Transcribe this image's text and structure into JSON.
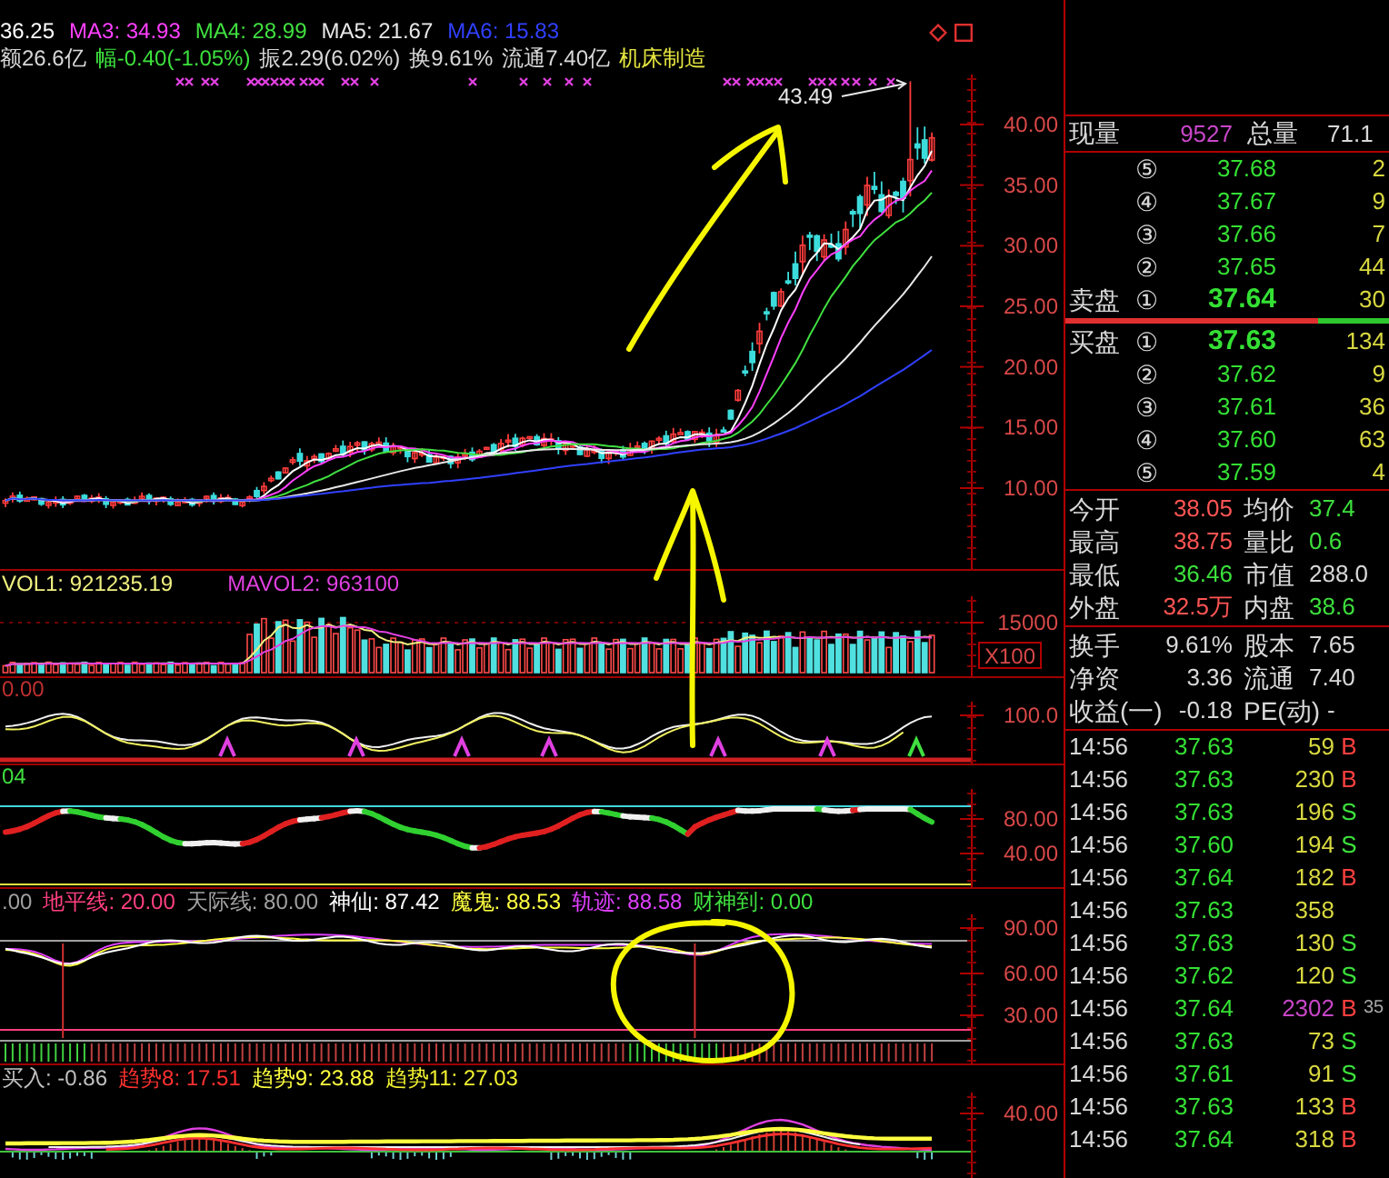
{
  "header": {
    "ma_legend": [
      {
        "text": "36.25",
        "color": "#ffffff"
      },
      {
        "text": "MA3: 34.93",
        "color": "#ff40ff"
      },
      {
        "text": "MA4: 28.99",
        "color": "#40e040"
      },
      {
        "text": "MA5: 21.67",
        "color": "#e8e8e8"
      },
      {
        "text": "MA6: 15.83",
        "color": "#3040ff"
      }
    ],
    "quote_line": [
      {
        "text": "额26.6亿",
        "color": "#d8d8d8"
      },
      {
        "text": "幅-0.40(-1.05%)",
        "color": "#3ce03c"
      },
      {
        "text": "振2.29(6.02%)",
        "color": "#d8d8d8"
      },
      {
        "text": "换9.61%",
        "color": "#d8d8d8"
      },
      {
        "text": "流通7.40亿",
        "color": "#d8d8d8"
      },
      {
        "text": "机床制造",
        "color": "#e6e640"
      }
    ]
  },
  "main_chart": {
    "price_axis": [
      "40.00",
      "35.00",
      "30.00",
      "25.00",
      "20.00",
      "15.00",
      "10.00"
    ],
    "peak_label": "43.49"
  },
  "volume_panel": {
    "legend": [
      {
        "text": "VOL1: 921235.19",
        "color": "#f0f080"
      },
      {
        "text": "MAVOL2: 963100",
        "color": "#e040e0"
      }
    ],
    "axis": [
      "15000"
    ],
    "scale": "X100"
  },
  "panel_3": {
    "legend": [
      {
        "text": "0.00",
        "color": "#c03030"
      }
    ],
    "axis": [
      "100.0"
    ],
    "signal_markers": [
      {
        "color": "#e040e0"
      },
      {
        "color": "#e040e0"
      },
      {
        "color": "#e040e0"
      },
      {
        "color": "#e040e0"
      },
      {
        "color": "#e040e0"
      },
      {
        "color": "#e040e0"
      },
      {
        "color": "#40e040"
      }
    ]
  },
  "panel_4": {
    "legend": [
      {
        "text": "04",
        "color": "#40e040"
      }
    ],
    "axis": [
      "80.00",
      "40.00"
    ]
  },
  "panel_5": {
    "legend": [
      {
        "text": ".00",
        "color": "#a0a0a0"
      },
      {
        "text": "地平线: 20.00",
        "color": "#ff4080"
      },
      {
        "text": "天际线: 80.00",
        "color": "#a0a0a0"
      },
      {
        "text": "神仙: 87.42",
        "color": "#ffffff"
      },
      {
        "text": "魔鬼: 88.53",
        "color": "#ffff40"
      },
      {
        "text": "轨迹: 88.58",
        "color": "#e040ff"
      },
      {
        "text": "财神到: 0.00",
        "color": "#40e040"
      }
    ],
    "axis": [
      "90.00",
      "60.00",
      "30.00"
    ]
  },
  "panel_6": {
    "legend": [
      {
        "text": "买入: -0.86",
        "color": "#c0c0c0"
      },
      {
        "text": "趋势8: 17.51",
        "color": "#ff3030"
      },
      {
        "text": "趋势9: 23.88",
        "color": "#ffff40"
      },
      {
        "text": "趋势11: 27.03",
        "color": "#f0f030"
      }
    ],
    "axis": [
      "40.00"
    ]
  },
  "quote_panel": {
    "current_volume": {
      "label": "现量",
      "value": "9527"
    },
    "total_volume": {
      "label": "总量",
      "value": "71.1"
    }
  },
  "order_book": {
    "sell_label": "卖盘",
    "buy_label": "买盘",
    "sell": [
      {
        "rank": "⑤",
        "price": "37.68",
        "volume": "2"
      },
      {
        "rank": "④",
        "price": "37.67",
        "volume": "9"
      },
      {
        "rank": "③",
        "price": "37.66",
        "volume": "7"
      },
      {
        "rank": "②",
        "price": "37.65",
        "volume": "44"
      },
      {
        "rank": "①",
        "price": "37.64",
        "volume": "30"
      }
    ],
    "pressure_bar": {
      "level": 0.78
    },
    "buy": [
      {
        "rank": "①",
        "price": "37.63",
        "volume": "134"
      },
      {
        "rank": "②",
        "price": "37.62",
        "volume": "9"
      },
      {
        "rank": "③",
        "price": "37.61",
        "volume": "36"
      },
      {
        "rank": "④",
        "price": "37.60",
        "volume": "63"
      },
      {
        "rank": "⑤",
        "price": "37.59",
        "volume": "4"
      }
    ]
  },
  "market_stats": [
    {
      "left": {
        "label": "今开",
        "value": "38.05",
        "color": "#ff5454"
      },
      "right": {
        "label": "均价",
        "value": "37.4",
        "color": "#3ce03c"
      }
    },
    {
      "left": {
        "label": "最高",
        "value": "38.75",
        "color": "#ff5454"
      },
      "right": {
        "label": "量比",
        "value": "0.6",
        "color": "#3ce03c"
      }
    },
    {
      "left": {
        "label": "最低",
        "value": "36.46",
        "color": "#3ce03c"
      },
      "right": {
        "label": "市值",
        "value": "288.0",
        "color": "#d8d8d8"
      }
    },
    {
      "left": {
        "label": "外盘",
        "value": "32.5万",
        "color": "#ff5454"
      },
      "right": {
        "label": "内盘",
        "value": "38.6",
        "color": "#3ce03c"
      }
    }
  ],
  "share_stats": [
    {
      "left": {
        "label": "换手",
        "value": "9.61%",
        "color": "#d8d8d8"
      },
      "right": {
        "label": "股本",
        "value": "7.65",
        "color": "#d8d8d8"
      }
    },
    {
      "left": {
        "label": "净资",
        "value": "3.36",
        "color": "#d8d8d8"
      },
      "right": {
        "label": "流通",
        "value": "7.40",
        "color": "#d8d8d8"
      }
    },
    {
      "left": {
        "label": "收益(一)",
        "value": "-0.18",
        "color": "#d8d8d8"
      },
      "right": {
        "label": "PE(动)",
        "value": "-",
        "color": "#d8d8d8"
      }
    }
  ],
  "ticks": [
    {
      "time": "14:56",
      "price": "37.63",
      "volume": "59",
      "side": "B",
      "kind": "buy",
      "large": false
    },
    {
      "time": "14:56",
      "price": "37.63",
      "volume": "230",
      "side": "B",
      "kind": "buy",
      "large": false
    },
    {
      "time": "14:56",
      "price": "37.63",
      "volume": "196",
      "side": "S",
      "kind": "sell",
      "large": false
    },
    {
      "time": "14:56",
      "price": "37.60",
      "volume": "194",
      "side": "S",
      "kind": "sell",
      "large": false
    },
    {
      "time": "14:56",
      "price": "37.64",
      "volume": "182",
      "side": "B",
      "kind": "buy",
      "large": false
    },
    {
      "time": "14:56",
      "price": "37.63",
      "volume": "358",
      "large": false
    },
    {
      "time": "14:56",
      "price": "37.63",
      "volume": "130",
      "side": "S",
      "kind": "sell",
      "large": false
    },
    {
      "time": "14:56",
      "price": "37.62",
      "volume": "120",
      "side": "S",
      "kind": "sell",
      "large": false
    },
    {
      "time": "14:56",
      "price": "37.64",
      "volume": "2302",
      "side": "B",
      "kind": "buy",
      "large": true,
      "column_5": "35"
    },
    {
      "time": "14:56",
      "price": "37.63",
      "volume": "73",
      "side": "S",
      "kind": "sell",
      "large": false
    },
    {
      "time": "14:56",
      "price": "37.61",
      "volume": "91",
      "side": "S",
      "kind": "sell",
      "large": false
    },
    {
      "time": "14:56",
      "price": "37.63",
      "volume": "133",
      "side": "B",
      "kind": "buy",
      "large": false
    },
    {
      "time": "14:56",
      "price": "37.64",
      "volume": "318",
      "side": "B",
      "kind": "buy",
      "large": false
    }
  ]
}
